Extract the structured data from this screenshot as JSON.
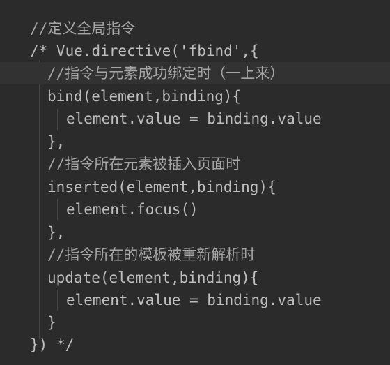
{
  "code": {
    "lines": [
      "//定义全局指令",
      "/* Vue.directive('fbind',{",
      "//指令与元素成功绑定时（一上来）",
      "bind(element,binding){",
      "element.value = binding.value",
      "},",
      "//指令所在元素被插入页面时",
      "inserted(element,binding){",
      "element.focus()",
      "},",
      "//指令所在的模板被重新解析时",
      "update(element,binding){",
      "element.value = binding.value",
      "}",
      "}) */"
    ]
  },
  "colors": {
    "background": "#2b2b2b",
    "text": "#bdbdbd",
    "current_line": "#323232",
    "indent_guide": "#454545"
  }
}
